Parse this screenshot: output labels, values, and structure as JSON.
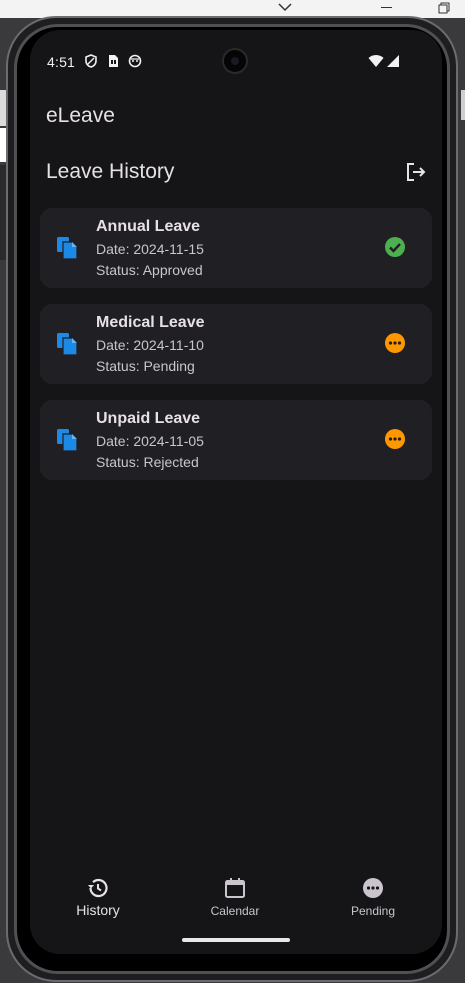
{
  "status_bar": {
    "time": "4:51",
    "icons": [
      "shield-icon",
      "sim-card-icon",
      "android-debug-icon",
      "wifi-icon",
      "signal-icon"
    ]
  },
  "app": {
    "title": "eLeave"
  },
  "page": {
    "title": "Leave History",
    "logout_icon": "logout-icon"
  },
  "leaves": [
    {
      "title": "Annual Leave",
      "date": "Date: 2024-11-15",
      "status": "Status: Approved",
      "status_icon": "check-circle-icon",
      "status_color": "#4caf50"
    },
    {
      "title": "Medical Leave",
      "date": "Date: 2024-11-10",
      "status": "Status: Pending",
      "status_icon": "more-circle-icon",
      "status_color": "#ff9800"
    },
    {
      "title": "Unpaid Leave",
      "date": "Date: 2024-11-05",
      "status": "Status: Rejected",
      "status_icon": "more-circle-icon",
      "status_color": "#ff9800"
    }
  ],
  "bottom_nav": {
    "items": [
      {
        "label": "History",
        "icon": "history-icon",
        "active": true
      },
      {
        "label": "Calendar",
        "icon": "calendar-icon",
        "active": false
      },
      {
        "label": "Pending",
        "icon": "more-circle-icon",
        "active": false
      }
    ]
  },
  "colors": {
    "background": "#151416",
    "card": "#201f23",
    "doc_icon": "#1e88e5",
    "approved": "#4caf50",
    "pending": "#ff9800"
  }
}
